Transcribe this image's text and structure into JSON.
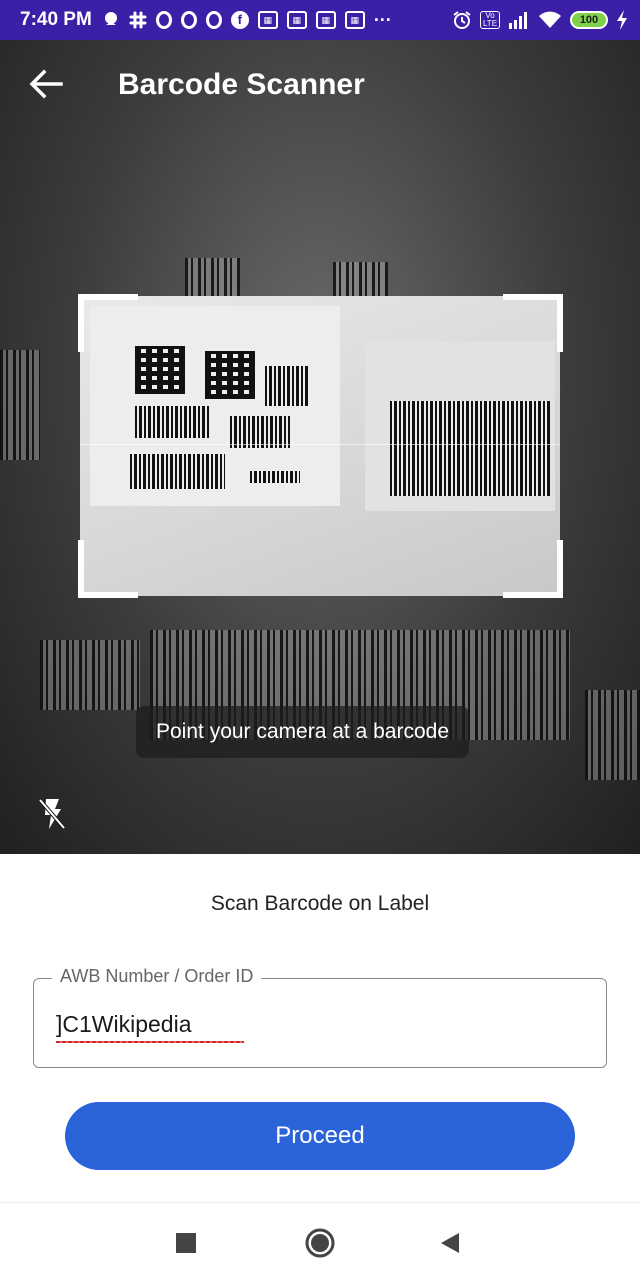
{
  "status_bar": {
    "time": "7:40 PM",
    "battery": "100",
    "network": "Vo LTE",
    "more": "···",
    "icons_left": [
      "chat-bubble-icon",
      "slack-icon",
      "ring-icon",
      "ring-icon",
      "ring-icon",
      "facebook-icon",
      "notification-box-icon",
      "notification-box-icon",
      "notification-box-icon",
      "notification-box-icon"
    ],
    "icons_right": [
      "alarm-icon",
      "volte-icon",
      "signal-icon",
      "wifi-icon",
      "battery-icon",
      "charging-icon"
    ]
  },
  "header": {
    "title": "Barcode Scanner",
    "back_icon": "arrow-left-icon"
  },
  "camera": {
    "hint": "Point your camera at a barcode",
    "flash_icon": "flash-off-icon"
  },
  "sheet": {
    "title": "Scan Barcode on Label",
    "field_label": "AWB Number / Order ID",
    "field_value": "]C1Wikipedia",
    "proceed_label": "Proceed",
    "accent_color": "#2b63d9"
  },
  "nav": {
    "recents_icon": "square-icon",
    "home_icon": "circle-icon",
    "back_icon": "triangle-back-icon"
  }
}
